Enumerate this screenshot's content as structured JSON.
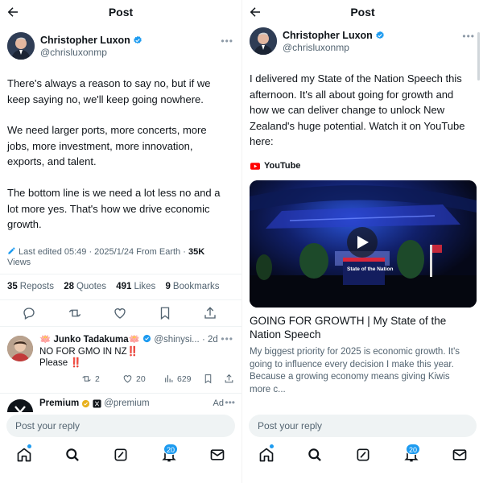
{
  "left": {
    "header": {
      "title": "Post"
    },
    "author": {
      "name": "Christopher Luxon",
      "handle": "@chrisluxonmp"
    },
    "body": {
      "p1": "There's always a reason to say no, but if we keep saying no, we'll keep going nowhere.",
      "p2": "We need larger ports, more concerts, more jobs, more investment, more innovation, exports, and talent.",
      "p3": "The bottom line is we need a lot less no and a lot more yes. That's how we drive economic growth."
    },
    "meta": {
      "edited": "Last edited 05:49 · 2025/1/24 From Earth ·",
      "views_count": "35K",
      "views_label": "Views"
    },
    "stats": {
      "reposts_count": "35",
      "reposts_label": "Reposts",
      "quotes_count": "28",
      "quotes_label": "Quotes",
      "likes_count": "491",
      "likes_label": "Likes",
      "bookmarks_count": "9",
      "bookmarks_label": "Bookmarks"
    },
    "reply": {
      "name": "🪷 Junko Tadakuma🪷",
      "handle": "@shinysi... · 2d",
      "line1": "NO FOR GMO IN NZ‼️",
      "line2": "Please ‼️",
      "retweets": "2",
      "likes": "20",
      "views": "629"
    },
    "ad": {
      "name": "Premium",
      "handle": "@premium",
      "tag": "Ad"
    },
    "reply_placeholder": "Post your reply",
    "notifications_badge": "20"
  },
  "right": {
    "header": {
      "title": "Post"
    },
    "author": {
      "name": "Christopher Luxon",
      "handle": "@chrisluxonmp"
    },
    "body": "I delivered my State of the Nation Speech this afternoon. It's all about going for growth and how we can deliver change to unlock New Zealand's huge potential. Watch it on YouTube here:",
    "card": {
      "source": "YouTube",
      "podium_text": "State of the Nation",
      "title": "GOING FOR GROWTH | My State of the Nation Speech",
      "description": "My biggest priority for 2025 is economic growth. It's going to influence every decision I make this year. Because a growing economy means giving Kiwis more c..."
    },
    "reply_placeholder": "Post your reply",
    "notifications_badge": "20"
  },
  "colors": {
    "accent": "#1d9bf0",
    "text": "#0f1419",
    "secondary": "#536471",
    "youtube": "#ff0000"
  }
}
